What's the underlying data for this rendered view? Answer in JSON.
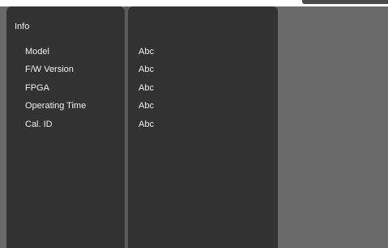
{
  "section": {
    "title": "Info"
  },
  "rows": [
    {
      "label": "Model",
      "value": "Abc"
    },
    {
      "label": "F/W Version",
      "value": "Abc"
    },
    {
      "label": "FPGA",
      "value": "Abc"
    },
    {
      "label": "Operating Time",
      "value": "Abc"
    },
    {
      "label": "Cal. ID",
      "value": "Abc"
    }
  ],
  "colors": {
    "panel": "#323232",
    "background": "#6a6a6a",
    "text": "#f0f0f0"
  }
}
